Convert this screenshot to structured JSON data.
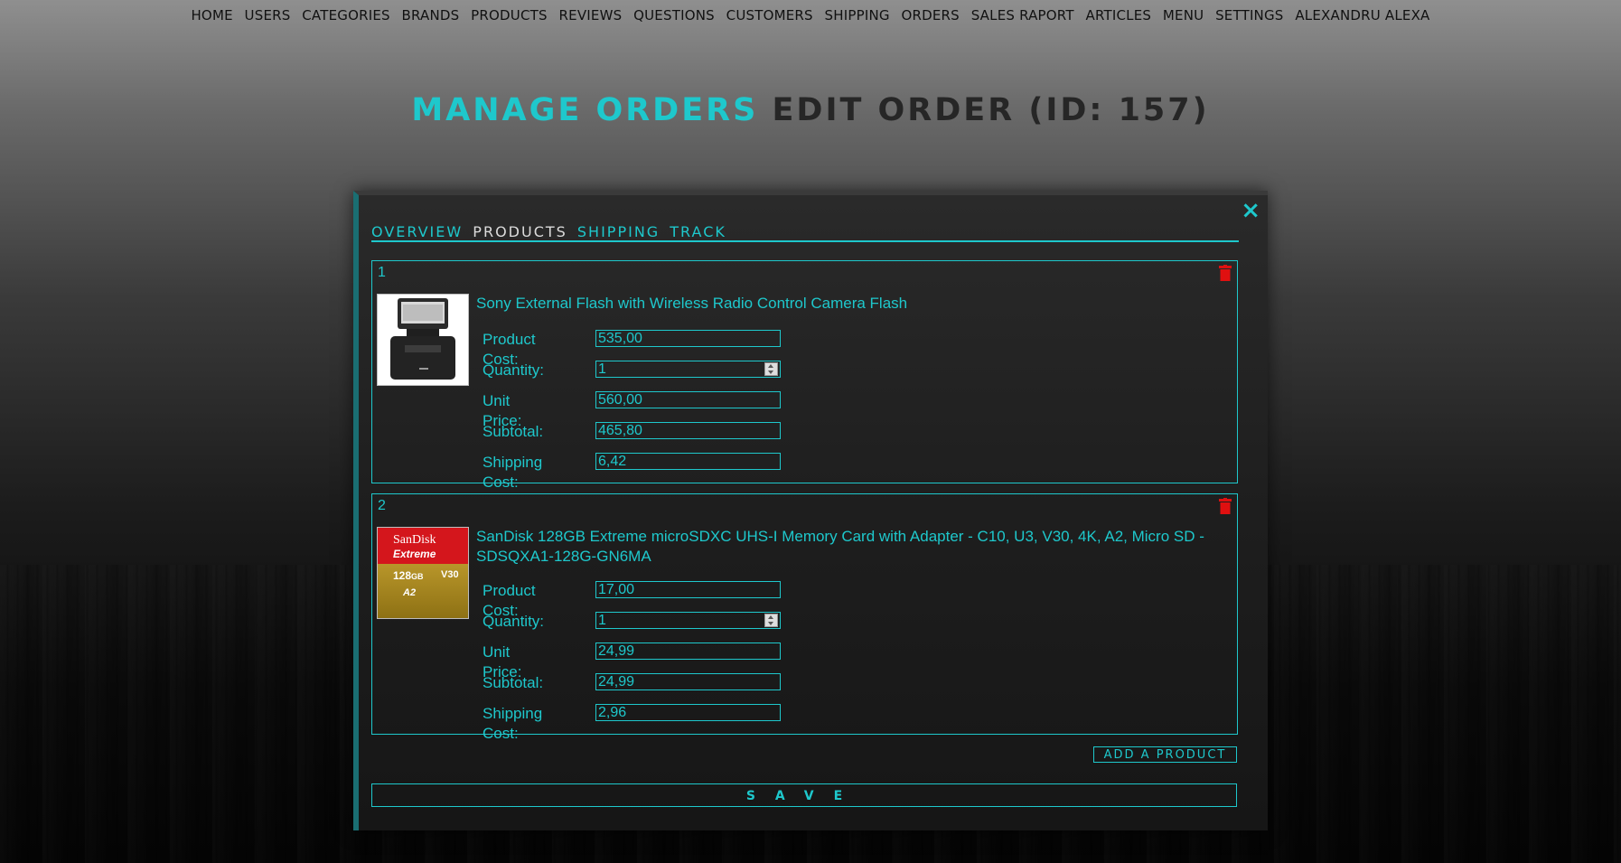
{
  "nav": [
    "HOME",
    "USERS",
    "CATEGORIES",
    "BRANDS",
    "PRODUCTS",
    "REVIEWS",
    "QUESTIONS",
    "CUSTOMERS",
    "SHIPPING",
    "ORDERS",
    "SALES RAPORT",
    "ARTICLES",
    "MENU",
    "SETTINGS",
    "ALEXANDRU ALEXA"
  ],
  "heading": {
    "accent": "MANAGE ORDERS",
    "main": "EDIT ORDER (ID: 157)"
  },
  "modal": {
    "close_icon": "×",
    "tabs": [
      "OVERVIEW",
      "PRODUCTS",
      "SHIPPING",
      "TRACK"
    ],
    "active_tab": "PRODUCTS",
    "labels": {
      "product_cost": "Product Cost:",
      "quantity": "Quantity:",
      "unit_price": "Unit Price:",
      "subtotal": "Subtotal:",
      "shipping_cost": "Shipping Cost:"
    },
    "items": [
      {
        "number": "1",
        "name": "Sony External Flash with Wireless Radio Control Camera Flash",
        "product_cost": "535,00",
        "quantity": "1",
        "unit_price": "560,00",
        "subtotal": "465,80",
        "shipping_cost": "6,42",
        "thumb_icon": "camera-flash-image"
      },
      {
        "number": "2",
        "name": "SanDisk 128GB Extreme microSDXC UHS-I Memory Card with Adapter - C10, U3, V30, 4K, A2, Micro SD - SDSQXA1-128G-GN6MA",
        "product_cost": "17,00",
        "quantity": "1",
        "unit_price": "24,99",
        "subtotal": "24,99",
        "shipping_cost": "2,96",
        "thumb_icon": "memory-card-image",
        "thumb_text": {
          "brand": "SanDisk",
          "line": "Extreme",
          "capacity": "128",
          "unit": "GB",
          "class": "V30",
          "a2": "A2"
        }
      }
    ],
    "add_product_label": "ADD A PRODUCT",
    "save_label": "SAVE"
  },
  "colors": {
    "accent": "#1ec8cc",
    "delete": "#e01010",
    "heading_dark": "#262626"
  }
}
